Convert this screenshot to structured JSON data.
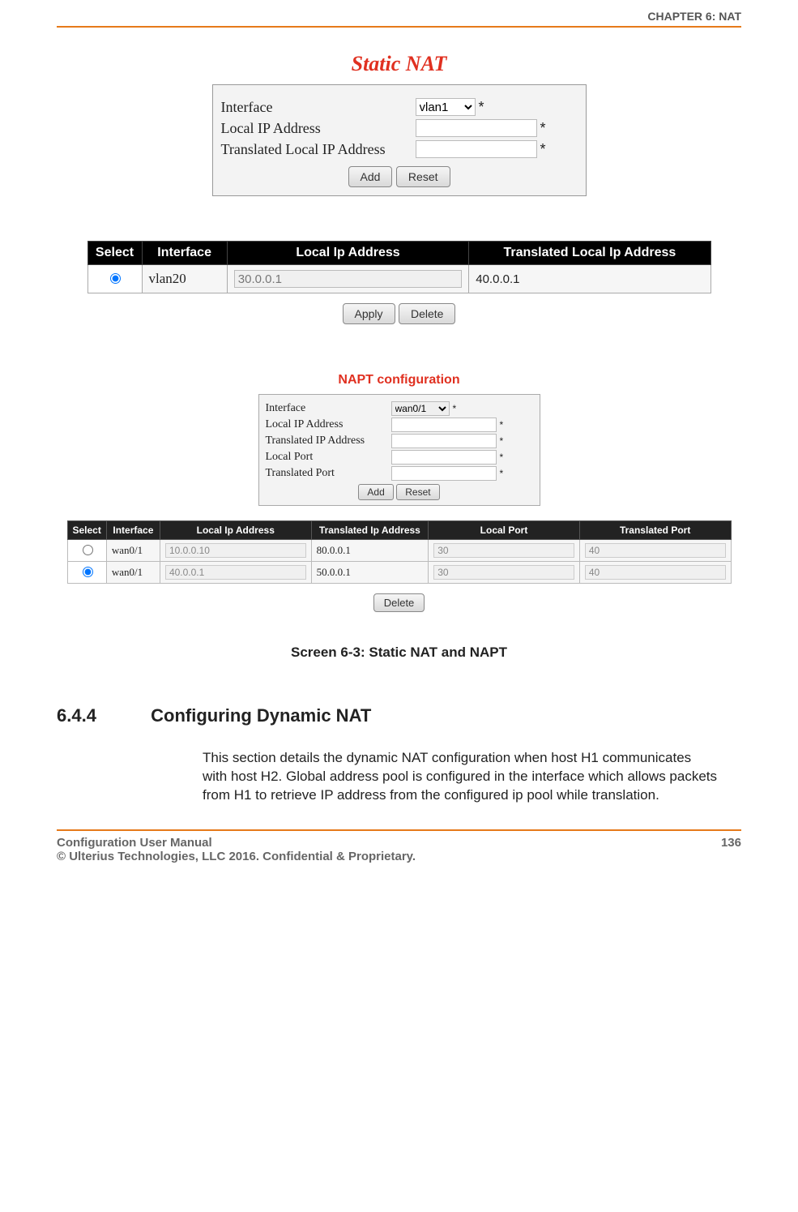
{
  "header": {
    "chapter": "CHAPTER 6: NAT"
  },
  "static_nat": {
    "title": "Static NAT",
    "labels": {
      "interface": "Interface",
      "local_ip": "Local IP Address",
      "translated_ip": "Translated Local IP Address"
    },
    "interface_value": "vlan1",
    "buttons": {
      "add": "Add",
      "reset": "Reset",
      "apply": "Apply",
      "delete": "Delete"
    },
    "columns": {
      "select": "Select",
      "interface": "Interface",
      "local_ip": "Local Ip Address",
      "translated_ip": "Translated Local Ip Address"
    },
    "rows": [
      {
        "selected": true,
        "interface": "vlan20",
        "local_ip": "30.0.0.1",
        "translated_ip": "40.0.0.1"
      }
    ]
  },
  "napt": {
    "title": "NAPT configuration",
    "labels": {
      "interface": "Interface",
      "local_ip": "Local IP Address",
      "translated_ip": "Translated IP Address",
      "local_port": "Local Port",
      "translated_port": "Translated Port"
    },
    "interface_value": "wan0/1",
    "buttons": {
      "add": "Add",
      "reset": "Reset",
      "delete": "Delete"
    },
    "columns": {
      "select": "Select",
      "interface": "Interface",
      "local_ip": "Local Ip Address",
      "translated_ip": "Translated Ip Address",
      "local_port": "Local Port",
      "translated_port": "Translated Port"
    },
    "rows": [
      {
        "selected": false,
        "interface": "wan0/1",
        "local_ip": "10.0.0.10",
        "translated_ip": "80.0.0.1",
        "local_port": "30",
        "translated_port": "40"
      },
      {
        "selected": true,
        "interface": "wan0/1",
        "local_ip": "40.0.0.1",
        "translated_ip": "50.0.0.1",
        "local_port": "30",
        "translated_port": "40"
      }
    ]
  },
  "caption": "Screen 6-3: Static NAT and NAPT",
  "section": {
    "number": "6.4.4",
    "title": "Configuring Dynamic NAT",
    "body": "This section details the dynamic NAT configuration when host H1 communicates with host H2. Global address pool is configured in the interface which allows packets from H1 to retrieve IP address from the configured ip pool while translation."
  },
  "footer": {
    "left1": "Configuration User Manual",
    "left2": "© Ulterius Technologies, LLC 2016. Confidential & Proprietary.",
    "page": "136"
  }
}
